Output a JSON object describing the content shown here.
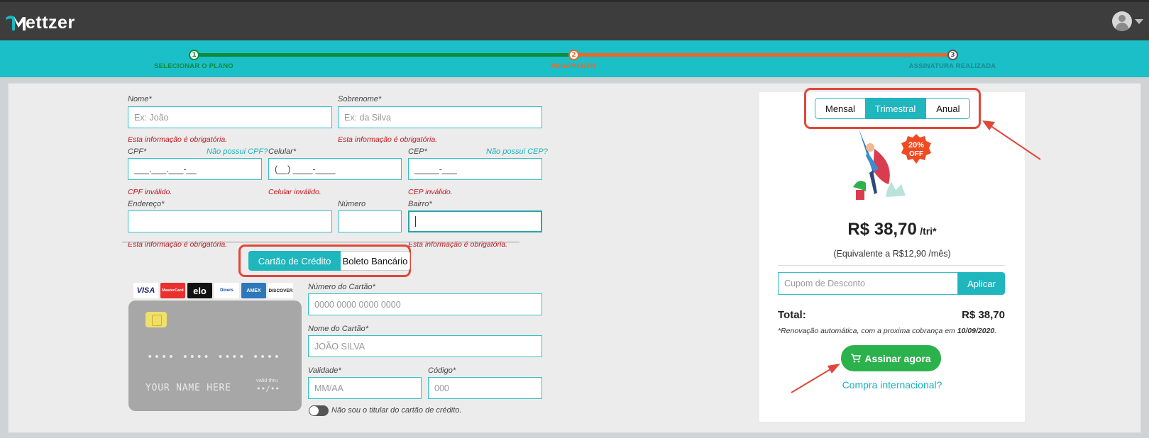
{
  "app": {
    "logo_text": "ettzer"
  },
  "stepper": {
    "steps": [
      {
        "number": "1",
        "label": "SELECIONAR O PLANO"
      },
      {
        "number": "2",
        "label": "PAGAMENTO"
      },
      {
        "number": "3",
        "label": "ASSINATURA REALIZADA"
      }
    ],
    "colors": {
      "done": "#0e8a3d",
      "current": "#e8692c",
      "pending": "#1a8a8f"
    }
  },
  "form": {
    "nome": {
      "label": "Nome*",
      "placeholder": "Ex: João",
      "error": "Esta informação é obrigatória."
    },
    "sobrenome": {
      "label": "Sobrenome*",
      "placeholder": "Ex: da Silva",
      "error": "Esta informação é obrigatória."
    },
    "cpf": {
      "label": "CPF*",
      "link": "Não possui CPF?",
      "mask": "___.___.___-__",
      "error": "CPF inválido."
    },
    "celular": {
      "label": "Celular*",
      "mask": "(__) ____-____",
      "error": "Celular inválido."
    },
    "cep": {
      "label": "CEP*",
      "link": "Não possui CEP?",
      "mask": "_____-___",
      "error": "CEP inválido."
    },
    "endereco": {
      "label": "Endereço*",
      "error": "Esta informação é obrigatória."
    },
    "numero": {
      "label": "Número"
    },
    "bairro": {
      "label": "Bairro*",
      "error": "Esta informação é obrigatória."
    }
  },
  "payment": {
    "methods": [
      "Cartão de Crédito",
      "Boleto Bancário"
    ],
    "selected": "Cartão de Crédito",
    "brands": [
      "VISA",
      "MasterCard",
      "elo",
      "Diners",
      "AMEX",
      "DISCOVER"
    ],
    "card_preview": {
      "number": "•••• •••• •••• ••••",
      "name": "YOUR NAME HERE",
      "valid_label": "valid thru",
      "valid": "••/••"
    },
    "card_number": {
      "label": "Número do Cartão*",
      "placeholder": "0000 0000 0000 0000"
    },
    "card_name": {
      "label": "Nome do Cartão*",
      "placeholder": "JOÃO SILVA"
    },
    "validade": {
      "label": "Validade*",
      "placeholder": "MM/AA"
    },
    "codigo": {
      "label": "Código*",
      "placeholder": "000"
    },
    "not_holder": "Não sou o titular do cartão de crédito."
  },
  "summary": {
    "plans": [
      "Mensal",
      "Trimestral",
      "Anual"
    ],
    "selected_plan": "Trimestral",
    "discount_badge": [
      "20%",
      "OFF"
    ],
    "price": "R$ 38,70",
    "period": "/tri*",
    "equivalent": "(Equivalente a R$12,90 /mês)",
    "coupon_placeholder": "Cupom de Desconto",
    "apply_label": "Aplicar",
    "total_label": "Total:",
    "total_value": "R$ 38,70",
    "renewal_text": "*Renovação automática, com a proxima cobrança em ",
    "renewal_date": "10/09/2020",
    "subscribe_label": "Assinar agora",
    "international_link": "Compra internacional?"
  }
}
